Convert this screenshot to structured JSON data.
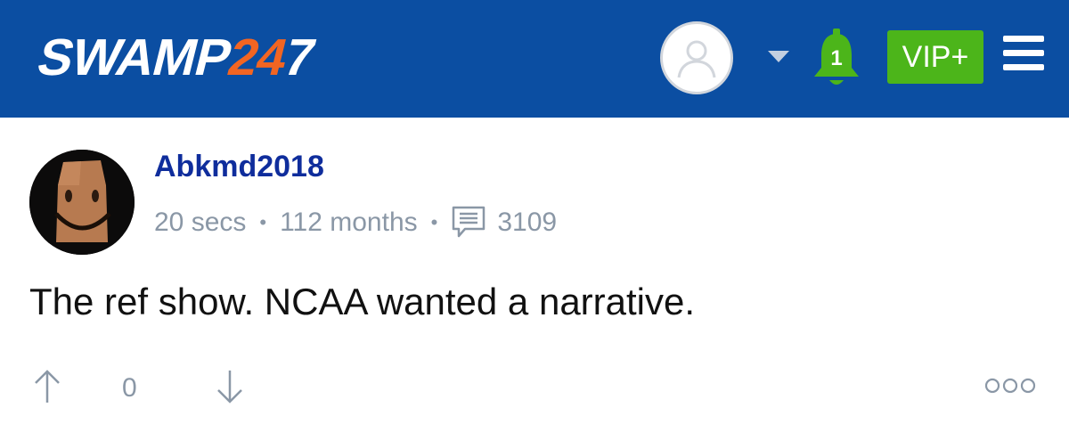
{
  "header": {
    "logo": {
      "word": "SWAMP",
      "number_part1": "24",
      "number_part2": "7"
    },
    "notifications_count": "1",
    "vip_label": "VIP+"
  },
  "post": {
    "username": "Abkmd2018",
    "time_ago": "20 secs",
    "member_for": "112 months",
    "post_count": "3109",
    "body": "The ref show. NCAA wanted a narrative.",
    "vote_score": "0"
  },
  "colors": {
    "header_bg": "#0b4ea2",
    "logo_accent": "#f26522",
    "vip_green": "#4cb51a",
    "username_blue": "#0f2d9c",
    "meta_gray": "#8a97a6"
  },
  "icons": {
    "profile": "user-silhouette-icon",
    "dropdown": "caret-down-icon",
    "notifications": "bell-icon",
    "menu": "hamburger-menu-icon",
    "posts": "comment-icon",
    "upvote": "arrow-up-icon",
    "downvote": "arrow-down-icon",
    "more": "more-options-icon"
  }
}
